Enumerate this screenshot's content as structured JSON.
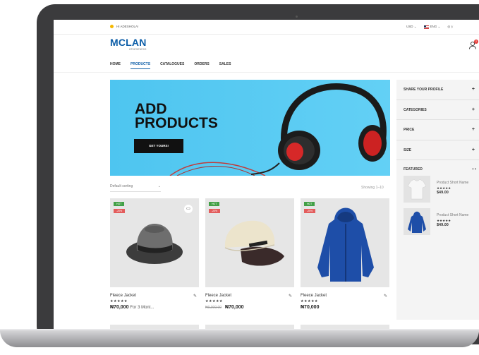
{
  "topbar": {
    "greeting": "HI ADESHOLA!",
    "currency": "USD ⌄",
    "language": "ENG ⌄",
    "social": "◎  𝕪"
  },
  "brand": {
    "name": "MCLAN",
    "sub": "eCommerce"
  },
  "header": {
    "cart_count": "2"
  },
  "nav": {
    "items": [
      "HOME",
      "PRODUCTS",
      "CATALOGUES",
      "ORDERS",
      "SALES"
    ],
    "active": "PRODUCTS"
  },
  "banner": {
    "title_line1": "ADD",
    "title_line2": "PRODUCTS",
    "button": "GET YOURS!"
  },
  "listing": {
    "sort_label": "Default sorting",
    "sort_chevron": "⌄",
    "showing": "Showing 1–10"
  },
  "products": [
    {
      "hot": "HOT",
      "discount": "-20%",
      "name": "Fleece Jacket",
      "stars": "★★★★★",
      "old_price": "",
      "price": "₦70,000",
      "price_suffix": "For 3 Mont...",
      "image": "fedora-hat"
    },
    {
      "hot": "HOT",
      "discount": "-20%",
      "name": "Fleece Jacket",
      "stars": "★★★★★",
      "old_price": "₦9,000.00",
      "price": "₦70,000",
      "price_suffix": "",
      "image": "baseball-cap"
    },
    {
      "hot": "HOT",
      "discount": "-20%",
      "name": "Fleece Jacket",
      "stars": "★★★★★",
      "old_price": "",
      "price": "₦70,000",
      "price_suffix": "",
      "image": "blue-hoodie"
    }
  ],
  "sidebar": {
    "sections": [
      "SHARE YOUR PROFILE",
      "CATEGORIES",
      "PRICE",
      "SIZE"
    ],
    "featured_title": "FEATURED",
    "featured_arrows": "‹ ›",
    "featured": [
      {
        "name": "Product Short Name",
        "stars": "★★★★★",
        "price": "$49.00",
        "image": "white-tshirt"
      },
      {
        "name": "Product Short Name",
        "stars": "★★★★★",
        "price": "$49.00",
        "image": "blue-hoodie"
      }
    ]
  },
  "colors": {
    "brand_blue": "#0d5ea8",
    "banner_blue": "#4ec5f0",
    "hot_green": "#43a047",
    "sale_red": "#e35d5d"
  }
}
